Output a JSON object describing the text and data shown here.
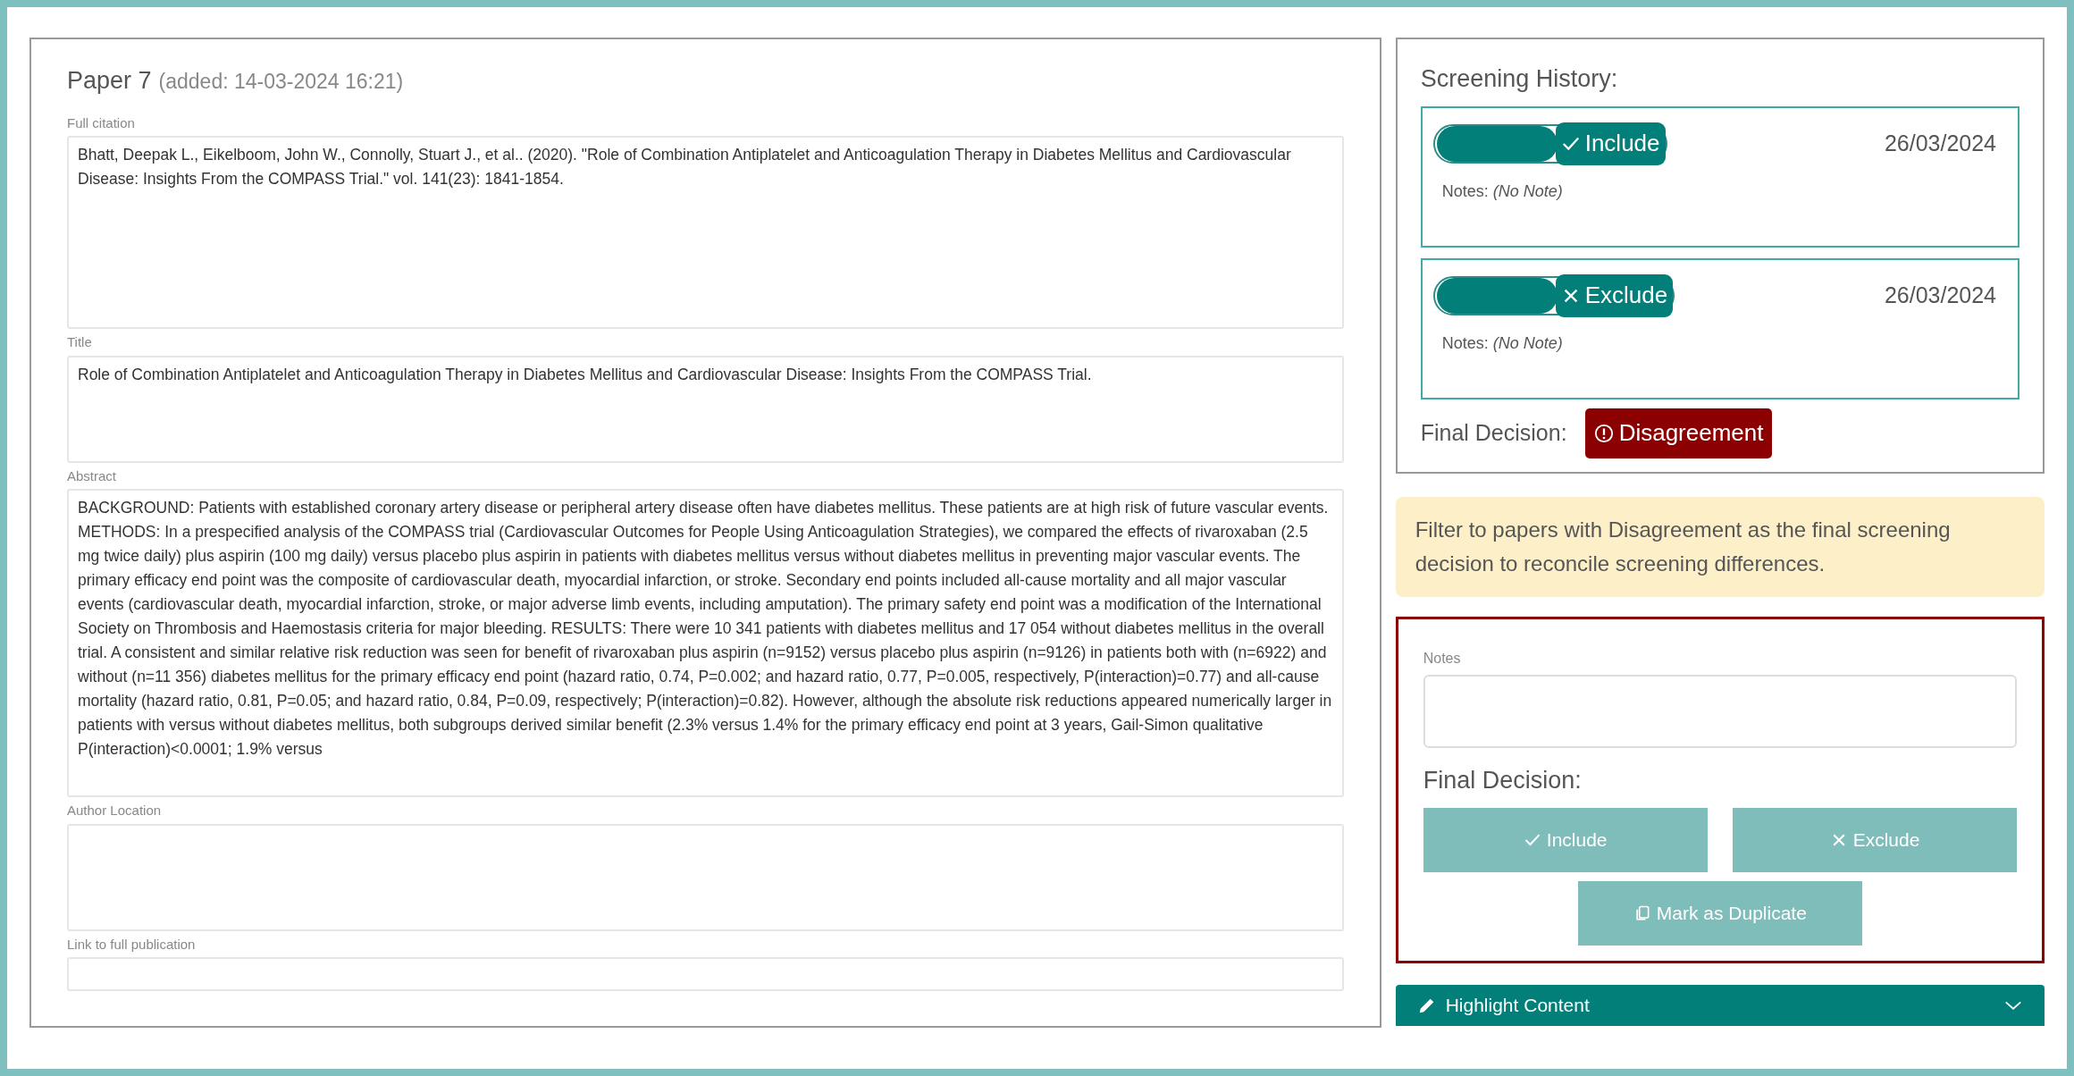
{
  "paper": {
    "title": "Paper 7",
    "added": "(added: 14-03-2024 16:21)"
  },
  "fields": [
    {
      "label": "Full citation",
      "value": "Bhatt, Deepak L., Eikelboom, John W., Connolly, Stuart J., et al.. (2020). \"Role of Combination Antiplatelet and Anticoagulation Therapy in Diabetes Mellitus and Cardiovascular Disease: Insights From the COMPASS Trial.\"  vol. 141(23): 1841-1854.",
      "kind": "large"
    },
    {
      "label": "Title",
      "value": "Role of Combination Antiplatelet and Anticoagulation Therapy in Diabetes Mellitus and Cardiovascular Disease: Insights From the COMPASS Trial.",
      "kind": "medium"
    },
    {
      "label": "Abstract",
      "value": "BACKGROUND: Patients with established coronary artery disease or peripheral artery disease often have diabetes mellitus. These patients are at high risk of future vascular events. METHODS: In a prespecified analysis of the COMPASS trial  (Cardiovascular Outcomes for People Using Anticoagulation Strategies), we  compared the effects of rivaroxaban (2.5 mg twice daily) plus aspirin (100 mg  daily) versus placebo plus aspirin in patients with diabetes mellitus versus  without diabetes mellitus in preventing major vascular events. The primary  efficacy end point was the composite of cardiovascular death, myocardial  infarction, or stroke. Secondary end points included all-cause mortality and all  major vascular events (cardiovascular death, myocardial infarction, stroke, or  major adverse limb events, including amputation). The primary safety end point  was a modification of the International Society on Thrombosis and Haemostasis  criteria for major bleeding. RESULTS: There were 10 341 patients with diabetes  mellitus and 17 054 without diabetes mellitus in the overall trial. A consistent  and similar relative risk reduction was seen for benefit of rivaroxaban plus  aspirin (n=9152) versus placebo plus aspirin (n=9126) in patients both with  (n=6922) and without (n=11 356) diabetes mellitus for the primary efficacy end  point (hazard ratio, 0.74, P=0.002; and hazard ratio, 0.77, P=0.005,  respectively, P(interaction)=0.77) and all-cause mortality (hazard ratio, 0.81,  P=0.05; and hazard ratio, 0.84, P=0.09, respectively; P(interaction)=0.82).  However, although the absolute risk reductions appeared numerically larger in  patients with versus without diabetes mellitus, both subgroups derived similar  benefit (2.3% versus 1.4% for the primary efficacy end point at 3 years,  Gail-Simon qualitative P(interaction)<0.0001; 1.9% versus",
      "kind": "abstract"
    },
    {
      "label": "Author Location",
      "kind": "medium"
    },
    {
      "label": "Link to full publication",
      "kind": "line"
    }
  ],
  "history": {
    "heading": "Screening History:",
    "entries": [
      {
        "decision": "Include",
        "kind": "include",
        "date": "26/03/2024",
        "notes_label": "Notes:",
        "note": "(No Note)"
      },
      {
        "decision": "Exclude",
        "kind": "exclude",
        "date": "26/03/2024",
        "notes_label": "Notes:",
        "note": "(No Note)"
      }
    ],
    "final_label": "Final Decision:",
    "final_badge": "Disagreement"
  },
  "info": "Filter to papers with Disagreement as the final screening decision to reconcile screening differences.",
  "decision_form": {
    "notes_label": "Notes",
    "final_label": "Final Decision:",
    "buttons": [
      {
        "label": "Include",
        "kind": "include"
      },
      {
        "label": "Exclude",
        "kind": "exclude"
      },
      {
        "label": "Mark as Duplicate",
        "kind": "duplicate"
      }
    ]
  },
  "accordion": {
    "label": "Highlight Content",
    "expanded": false
  }
}
